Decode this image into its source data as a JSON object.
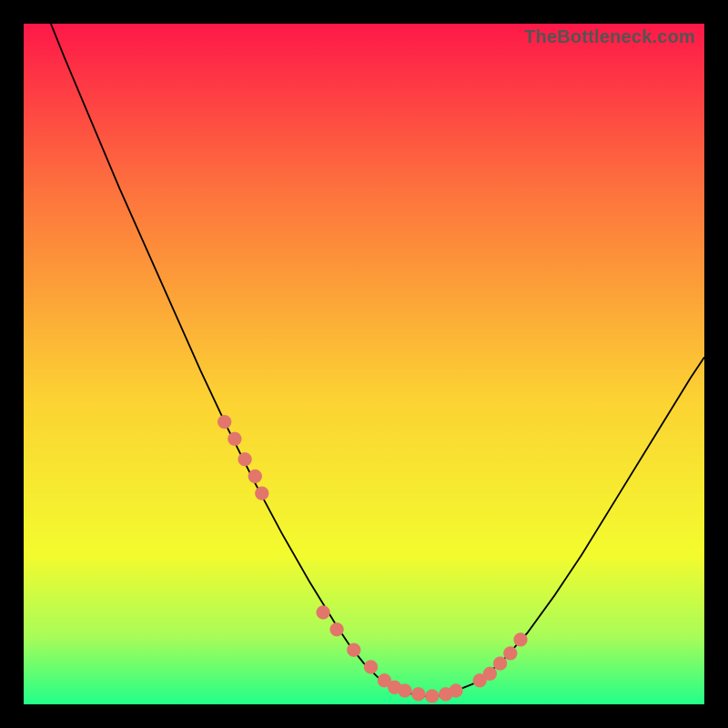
{
  "watermark": "TheBottleneck.com",
  "colors": {
    "gradient_top": "#fe1848",
    "gradient_mid1": "#fd743d",
    "gradient_mid2": "#fcd233",
    "gradient_mid3": "#f3fb2e",
    "gradient_mid4": "#a9fc58",
    "gradient_bottom": "#22ff89",
    "curve": "#000000",
    "marker": "#e2766b",
    "frame": "#000000"
  },
  "chart_data": {
    "type": "line",
    "title": "",
    "xlabel": "",
    "ylabel": "",
    "xlim": [
      0,
      100
    ],
    "ylim": [
      0,
      100
    ],
    "series": [
      {
        "name": "curve",
        "x": [
          4,
          6,
          10,
          14,
          18,
          22,
          26,
          30,
          34,
          38,
          42,
          46,
          48,
          50,
          52,
          54,
          56,
          58,
          60,
          62,
          66,
          70,
          74,
          78,
          82,
          86,
          90,
          94,
          98,
          100
        ],
        "y": [
          100,
          95,
          85.5,
          76,
          67,
          58,
          49,
          40.5,
          32.5,
          25,
          18,
          11.5,
          8.5,
          6,
          4,
          2.7,
          1.8,
          1.3,
          1.1,
          1.4,
          3,
          6,
          10.5,
          16,
          22,
          28.5,
          35,
          41.5,
          48,
          51
        ]
      }
    ],
    "markers": {
      "name": "highlighted-points",
      "x": [
        29.5,
        31,
        32.5,
        34,
        35,
        44,
        46,
        48.5,
        51,
        53,
        54.5,
        56,
        58,
        60,
        62,
        63.5,
        67,
        68.5,
        70,
        71.5,
        73
      ],
      "y": [
        41.5,
        39,
        36,
        33.5,
        31,
        13.5,
        11,
        8,
        5.5,
        3.5,
        2.5,
        2,
        1.5,
        1.2,
        1.5,
        2,
        3.5,
        4.5,
        6,
        7.5,
        9.5
      ]
    }
  }
}
